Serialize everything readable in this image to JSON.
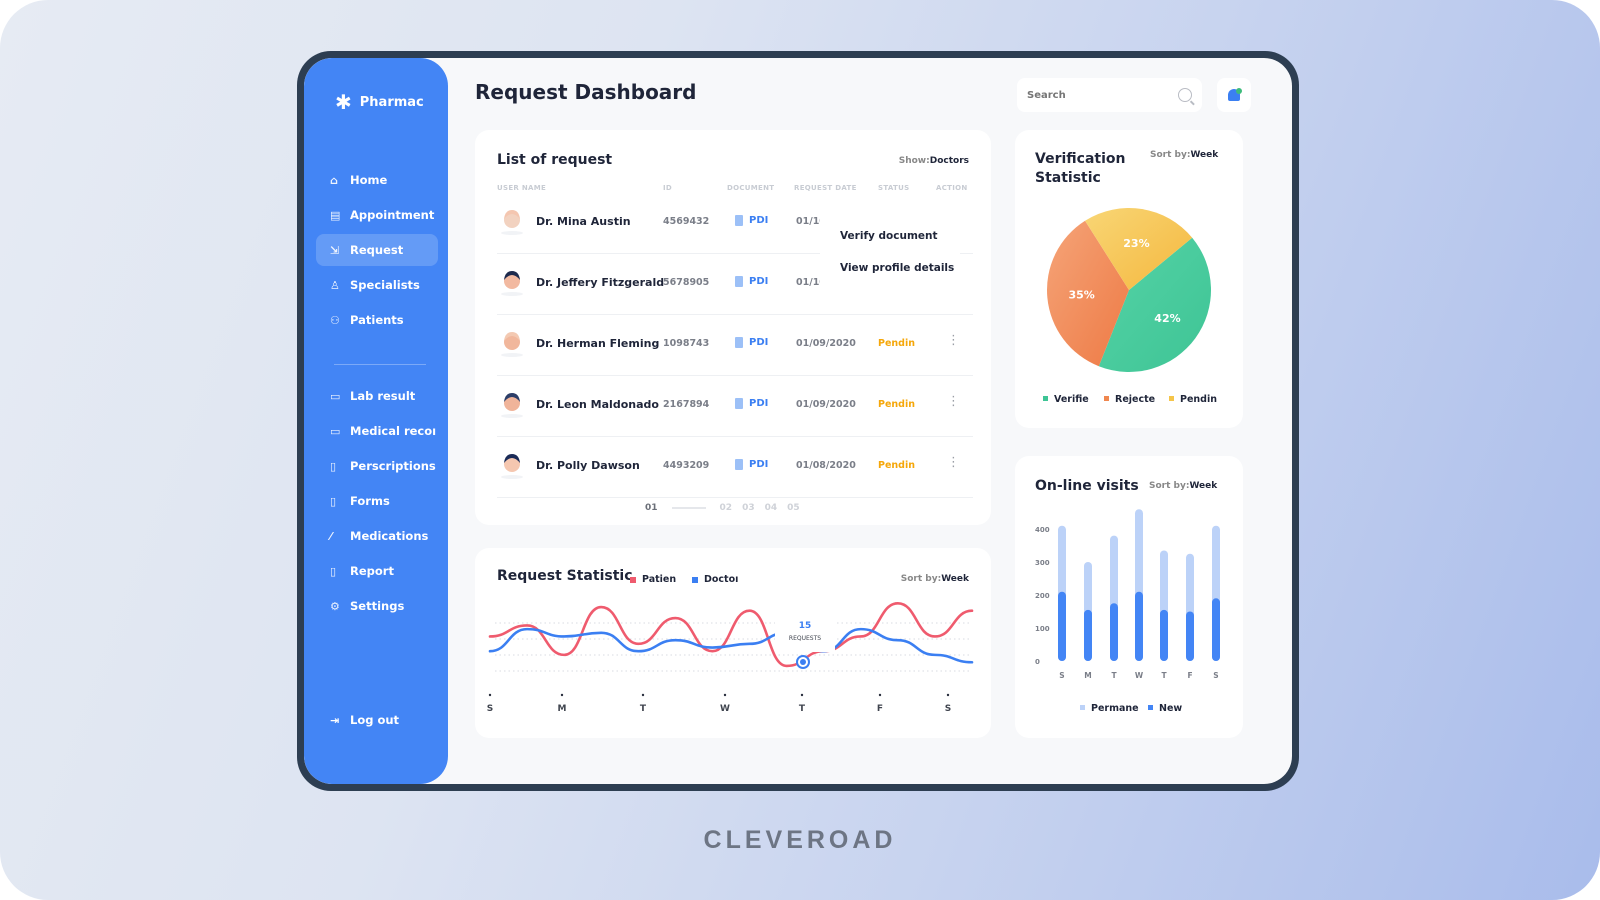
{
  "app": {
    "brand": "Pharmac",
    "page_title": "Request Dashboard"
  },
  "sidebar": {
    "items": [
      {
        "label": "Home",
        "icon": "home-icon"
      },
      {
        "label": "Appointment",
        "icon": "calendar-icon"
      },
      {
        "label": "Request",
        "icon": "request-icon",
        "active": true
      },
      {
        "label": "Specialists",
        "icon": "user-icon"
      },
      {
        "label": "Patients",
        "icon": "users-icon"
      }
    ],
    "items2": [
      {
        "label": "Lab result",
        "icon": "lab-icon"
      },
      {
        "label": "Medical recoı",
        "icon": "folder-icon"
      },
      {
        "label": "Perscriptions",
        "icon": "file-icon"
      },
      {
        "label": "Forms",
        "icon": "forms-icon"
      },
      {
        "label": "Medications",
        "icon": "pipette-icon"
      },
      {
        "label": "Report",
        "icon": "report-icon"
      },
      {
        "label": "Settings",
        "icon": "settings-icon"
      }
    ],
    "logout": "Log out"
  },
  "header": {
    "search_placeholder": "Search"
  },
  "requests": {
    "title": "List of request",
    "show_label": "Show:",
    "show_value": "Doctors",
    "columns": [
      "USER NAME",
      "ID",
      "DOCUMENT",
      "REQUEST DATE",
      "STATUS",
      "ACTION"
    ],
    "rows": [
      {
        "name": "Dr. Mina Austin",
        "id": "4569432",
        "doc": "PDI",
        "date": "01/10/2",
        "status": ""
      },
      {
        "name": "Dr. Jeffery Fitzgerald",
        "id": "5678905",
        "doc": "PDI",
        "date": "01/10/.",
        "status": ""
      },
      {
        "name": "Dr. Herman Fleming",
        "id": "1098743",
        "doc": "PDI",
        "date": "01/09/2020",
        "status": "Pendin"
      },
      {
        "name": "Dr. Leon Maldonado",
        "id": "2167894",
        "doc": "PDI",
        "date": "01/09/2020",
        "status": "Pendin"
      },
      {
        "name": "Dr. Polly Dawson",
        "id": "4493209",
        "doc": "PDI",
        "date": "01/08/2020",
        "status": "Pendin"
      }
    ],
    "context_menu": [
      "Verify document",
      "View profile details"
    ],
    "pages": [
      "01",
      "02",
      "03",
      "04",
      "05"
    ],
    "current_page": "01"
  },
  "colors": {
    "accent": "#4385f5",
    "patients_line": "#ef5b6e",
    "doctors_line": "#3b7ff2",
    "verified": "#3ec495",
    "rejected": "#f0874f",
    "pending": "#f5c54a",
    "permanent": "#bcd2f8",
    "new": "#4385f5"
  },
  "chart_data": [
    {
      "type": "line",
      "title": "Request Statistic",
      "sort_label": "Sort by:",
      "sort_value": "Week",
      "categories": [
        "S",
        "M",
        "T",
        "W",
        "T",
        "F",
        "S"
      ],
      "series": [
        {
          "name": "Patien",
          "values": [
            14,
            17,
            9,
            22,
            12,
            19,
            10,
            21,
            6,
            10,
            14,
            23,
            14,
            21
          ]
        },
        {
          "name": "Doctoı",
          "values": [
            10,
            16,
            14,
            15,
            10,
            13,
            11,
            12,
            15,
            10,
            16,
            13,
            9,
            7
          ]
        }
      ],
      "tooltip": {
        "value": "15",
        "label": "REQUESTS",
        "category": "T"
      }
    },
    {
      "type": "pie",
      "title": "Verification Statistic",
      "sort_label": "Sort by:",
      "sort_value": "Week",
      "slices": [
        {
          "label": "Verifie",
          "value": 42
        },
        {
          "label": "Rejecte",
          "value": 35
        },
        {
          "label": "Pendin",
          "value": 23
        }
      ]
    },
    {
      "type": "bar",
      "title": "On-line visits",
      "sort_label": "Sort by:",
      "sort_value": "Week",
      "categories": [
        "S",
        "M",
        "T",
        "W",
        "T",
        "F",
        "S"
      ],
      "yticks": [
        "0",
        "100",
        "200",
        "300",
        "400"
      ],
      "ylim": [
        0,
        450
      ],
      "series": [
        {
          "name": "Permane",
          "values": [
            410,
            300,
            380,
            460,
            335,
            325,
            410
          ]
        },
        {
          "name": "New",
          "values": [
            210,
            155,
            175,
            210,
            155,
            150,
            190
          ]
        }
      ]
    }
  ],
  "footer": {
    "brand": "CLEVEROAD"
  }
}
